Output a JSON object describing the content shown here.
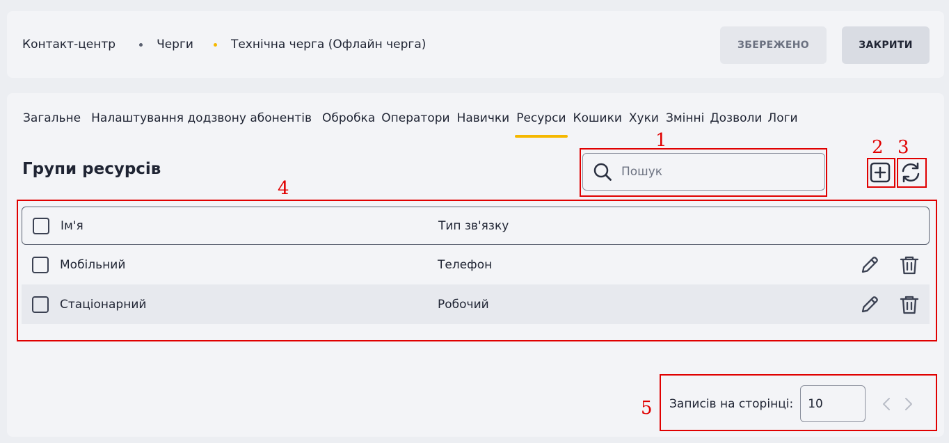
{
  "breadcrumb": {
    "items": [
      "Контакт-центр",
      "Черги",
      "Технічна черга (Офлайн черга)"
    ]
  },
  "header": {
    "saved_label": "ЗБЕРЕЖЕНО",
    "close_label": "ЗАКРИТИ"
  },
  "tabs": [
    {
      "label": "Загальне"
    },
    {
      "label": "Налаштування додзвону абонентів"
    },
    {
      "label": "Обробка"
    },
    {
      "label": "Оператори"
    },
    {
      "label": "Навички"
    },
    {
      "label": "Ресурси",
      "active": true
    },
    {
      "label": "Кошики"
    },
    {
      "label": "Хуки"
    },
    {
      "label": "Змінні"
    },
    {
      "label": "Дозволи"
    },
    {
      "label": "Логи"
    }
  ],
  "section": {
    "title": "Групи ресурсів"
  },
  "search": {
    "placeholder": "Пошук",
    "value": ""
  },
  "table": {
    "columns": [
      "Ім'я",
      "Тип зв'язку"
    ],
    "rows": [
      {
        "name": "Мобільний",
        "type": "Телефон"
      },
      {
        "name": "Стаціонарний",
        "type": "Робочий"
      }
    ]
  },
  "pagination": {
    "label": "Записів на сторінці:",
    "per_page": "10"
  },
  "annotations": [
    "1",
    "2",
    "3",
    "4",
    "5"
  ],
  "colors": {
    "accent": "#f5b800",
    "annotation": "#e00000"
  }
}
